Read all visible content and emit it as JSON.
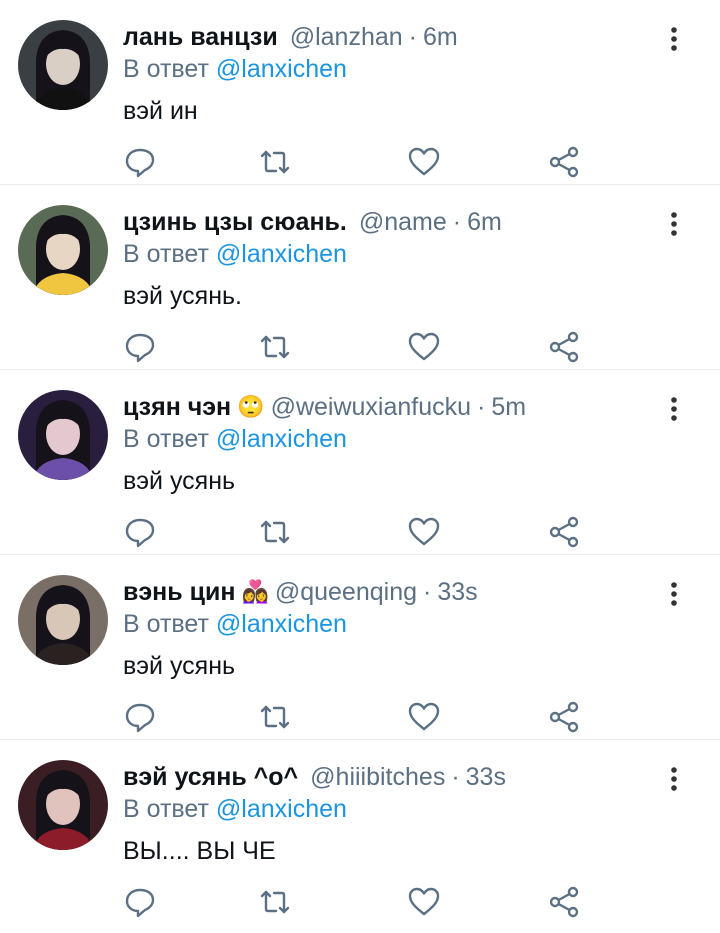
{
  "colors": {
    "name": "#0f1419",
    "secondary": "#5b7083",
    "mention": "#1b95e0",
    "divider": "#e6ecf0",
    "icon": "#5b7083"
  },
  "tweets": [
    {
      "name": "лань ванцзи",
      "emoji": "",
      "handle": "@lanzhan",
      "time": "6m",
      "reply_prefix": "В ответ",
      "reply_to": "@lanxichen",
      "text": "вэй ин",
      "avatar_colors": [
        "#3a3f44",
        "#d9cfc4",
        "#111111"
      ]
    },
    {
      "name": "цзинь цзы сюань.",
      "emoji": "",
      "handle": "@name",
      "time": "6m",
      "reply_prefix": "В ответ",
      "reply_to": "@lanxichen",
      "text": "вэй усянь.",
      "avatar_colors": [
        "#5a6b55",
        "#e8d6c4",
        "#f0c640"
      ]
    },
    {
      "name": "цзян чэн",
      "emoji": "🙄",
      "handle": "@weiwuxianfucku",
      "time": "5m",
      "reply_prefix": "В ответ",
      "reply_to": "@lanxichen",
      "text": "вэй усянь",
      "avatar_colors": [
        "#2a1e3e",
        "#e3c9cf",
        "#6b4fa8"
      ]
    },
    {
      "name": "вэнь цин",
      "emoji": "👩‍❤️‍👩",
      "handle": "@queenqing",
      "time": "33s",
      "reply_prefix": "В ответ",
      "reply_to": "@lanxichen",
      "text": "вэй усянь",
      "avatar_colors": [
        "#7a6f66",
        "#d8c6b6",
        "#2a2220"
      ]
    },
    {
      "name": "вэй усянь ^о^",
      "emoji": "",
      "handle": "@hiiibitches",
      "time": "33s",
      "reply_prefix": "В ответ",
      "reply_to": "@lanxichen",
      "text": "ВЫ.... ВЫ ЧЕ",
      "avatar_colors": [
        "#3b1e24",
        "#e0c3bd",
        "#8c1c2a"
      ]
    }
  ],
  "icons": {
    "more": "more-vertical-icon",
    "reply": "reply-icon",
    "retweet": "retweet-icon",
    "like": "heart-icon",
    "share": "share-icon"
  }
}
